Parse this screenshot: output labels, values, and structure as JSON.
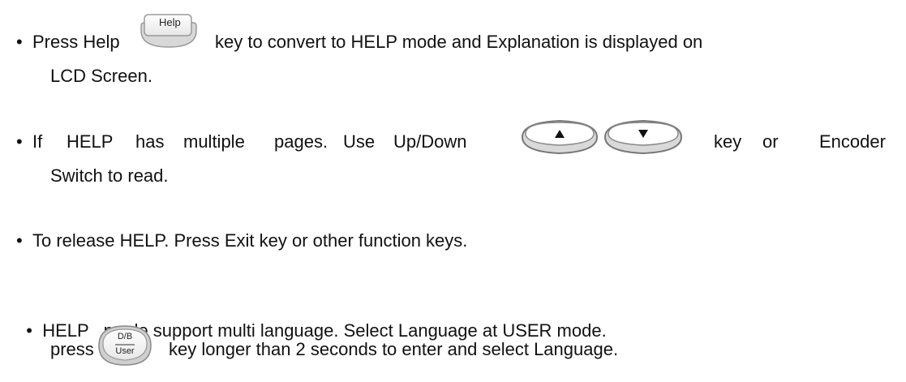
{
  "bullets": [
    {
      "line1_before": "Press Help",
      "key_label": "Help",
      "line1_after": "key to convert to HELP mode and Explanation is displayed on",
      "line2": "LCD Screen."
    },
    {
      "line1_p1": "If",
      "line1_p2": "HELP",
      "line1_p3": "has",
      "line1_p4": "multiple",
      "line1_p5": "pages.",
      "line1_p6": "Use",
      "line1_p7": "Up/Down",
      "line1_after1": "key",
      "line1_after2": "or",
      "line1_after3": "Encoder",
      "line2": "Switch to read.",
      "up_icon": "up-triangle-icon",
      "down_icon": "down-triangle-icon"
    },
    {
      "line1": "To release HELP. Press Exit key or other function keys."
    },
    {
      "line1": "HELP   mode support multi language. Select Language at USER mode.",
      "line2_before": "press",
      "key_top": "D/B",
      "key_bottom": "User",
      "line2_after": "key longer than 2 seconds to enter and select Language."
    }
  ],
  "bullet_symbol": "•"
}
